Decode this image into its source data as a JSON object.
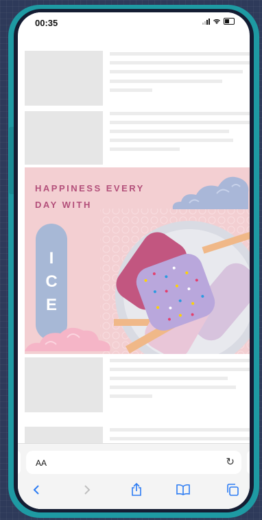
{
  "status_bar": {
    "time": "00:35"
  },
  "ad": {
    "headline_line1": "HAPPINESS EVERY",
    "headline_line2": "DAY WITH",
    "vertical_letters": [
      "I",
      "C",
      "E"
    ],
    "colors": {
      "background": "#f3cfd2",
      "headline": "#b34f7a",
      "pill": "#a7b8d6"
    }
  },
  "address_bar": {
    "text_size_label": "AA"
  },
  "toolbar": {
    "icons": [
      "back-icon",
      "forward-icon",
      "share-icon",
      "bookmarks-icon",
      "tabs-icon"
    ]
  }
}
